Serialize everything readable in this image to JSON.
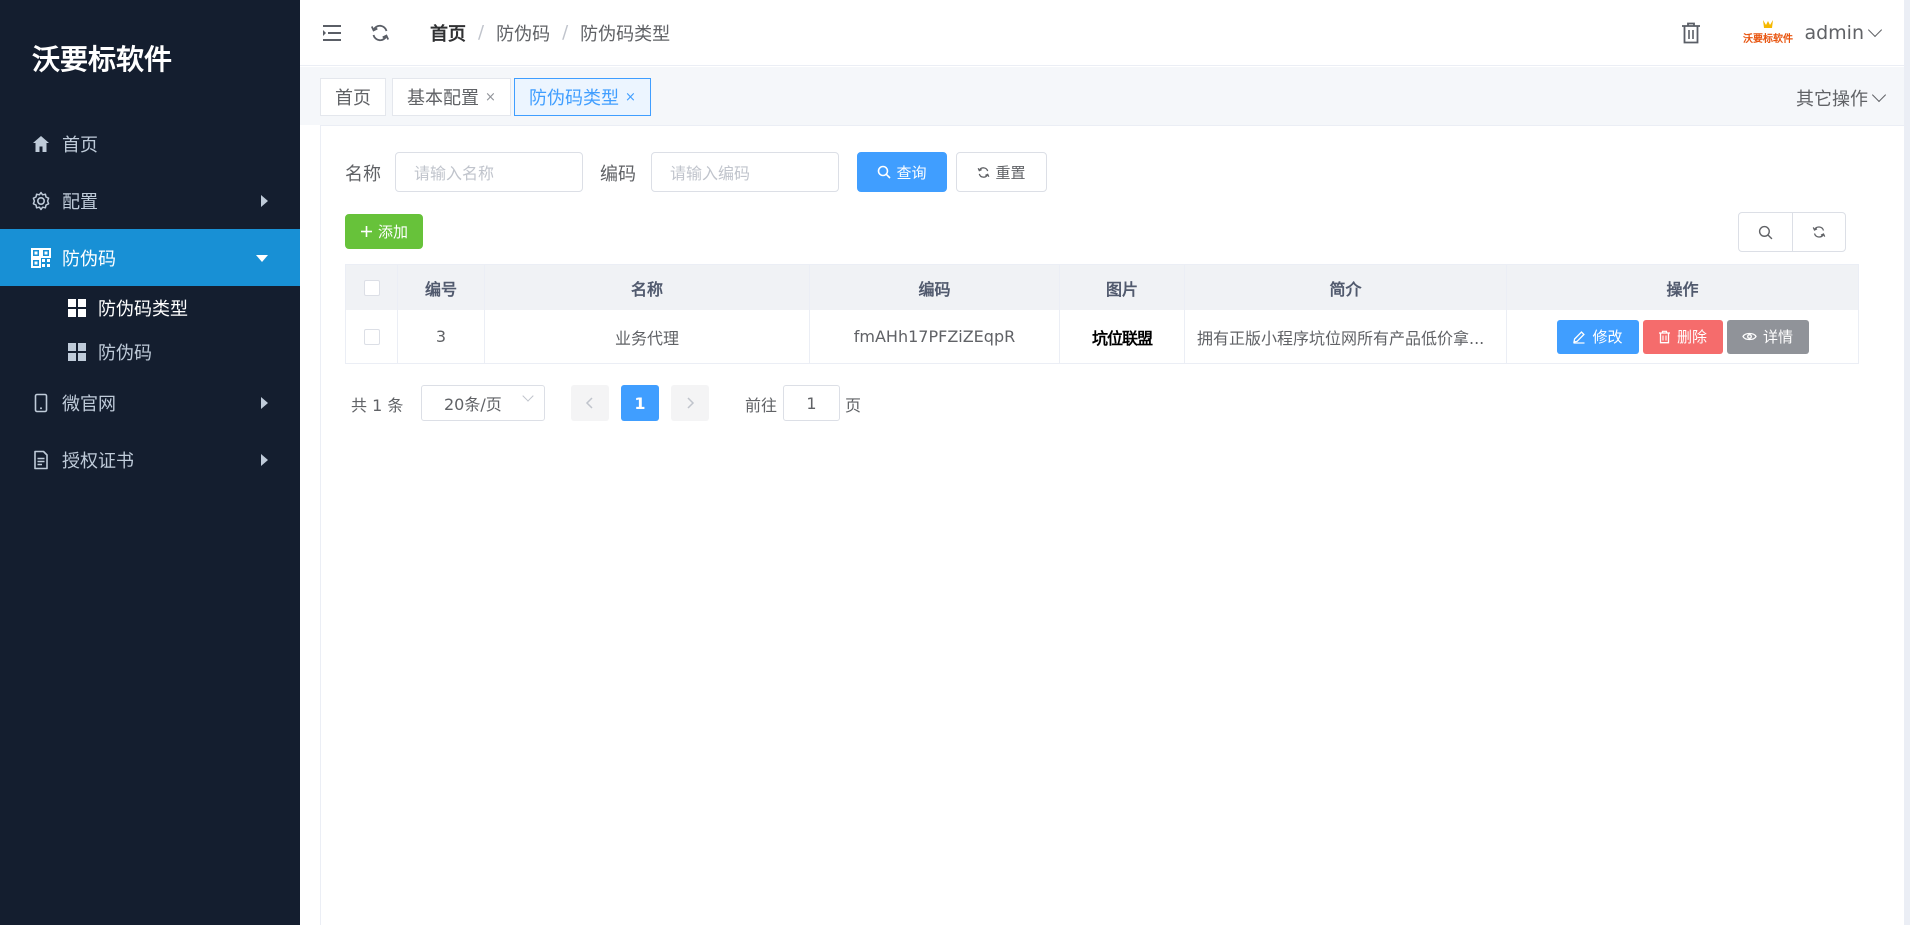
{
  "brand": "沃要标软件",
  "sidebar": {
    "items": [
      {
        "label": "首页",
        "icon": "home-icon"
      },
      {
        "label": "配置",
        "icon": "gear-icon"
      },
      {
        "label": "防伪码",
        "icon": "qrcode-icon"
      },
      {
        "label": "微官网",
        "icon": "mobile-icon"
      },
      {
        "label": "授权证书",
        "icon": "document-icon"
      }
    ],
    "sub_items": [
      {
        "label": "防伪码类型",
        "icon": "grid-icon"
      },
      {
        "label": "防伪码",
        "icon": "grid-icon"
      }
    ]
  },
  "header": {
    "breadcrumb": [
      "首页",
      "防伪码",
      "防伪码类型"
    ],
    "username": "admin",
    "avatar_text": "沃要标软件"
  },
  "tags": {
    "items": [
      {
        "label": "首页",
        "closable": false
      },
      {
        "label": "基本配置",
        "closable": true,
        "close": "×"
      },
      {
        "label": "防伪码类型",
        "closable": true,
        "close": "×"
      }
    ],
    "other_ops": "其它操作"
  },
  "filters": {
    "name_label": "名称",
    "name_placeholder": "请输入名称",
    "code_label": "编码",
    "code_placeholder": "请输入编码",
    "search_label": "查询",
    "reset_label": "重置",
    "add_label": "添加"
  },
  "table": {
    "columns": [
      "编号",
      "名称",
      "编码",
      "图片",
      "简介",
      "操作"
    ],
    "rows": [
      {
        "id": "3",
        "name": "业务代理",
        "code": "fmAHh17PFZiZEqpR",
        "image_text": "坑位联盟",
        "intro": "拥有正版小程序坑位网所有产品低价拿..."
      }
    ],
    "actions": {
      "edit": "修改",
      "delete": "删除",
      "view": "详情"
    }
  },
  "pagination": {
    "total": "共 1 条",
    "page_size": "20条/页",
    "current_page": "1",
    "goto_prefix": "前往",
    "goto_value": "1",
    "goto_suffix": "页"
  },
  "colors": {
    "sidebar_bg": "#141e2f",
    "active_menu": "#1890d5",
    "primary": "#409eff",
    "success": "#67c23a",
    "danger": "#f56c6c",
    "info": "#909399"
  }
}
